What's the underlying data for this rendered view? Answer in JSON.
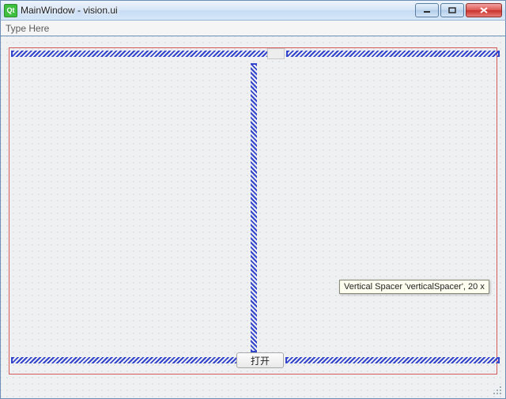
{
  "window": {
    "title": "MainWindow - vision.ui",
    "app_icon_text": "Qt"
  },
  "menubar": {
    "placeholder_hint": "Type Here"
  },
  "layout": {
    "button_label": "打开",
    "spacers": {
      "top_left": {
        "name": "horizontalSpacer",
        "orientation": "horizontal"
      },
      "top_right": {
        "name": "horizontalSpacer_2",
        "orientation": "horizontal"
      },
      "middle": {
        "name": "verticalSpacer",
        "orientation": "vertical"
      },
      "bottom_left": {
        "name": "horizontalSpacer_3",
        "orientation": "horizontal"
      },
      "bottom_right": {
        "name": "horizontalSpacer_4",
        "orientation": "horizontal"
      }
    }
  },
  "tooltip": {
    "text": "Vertical Spacer 'verticalSpacer', 20 x"
  }
}
